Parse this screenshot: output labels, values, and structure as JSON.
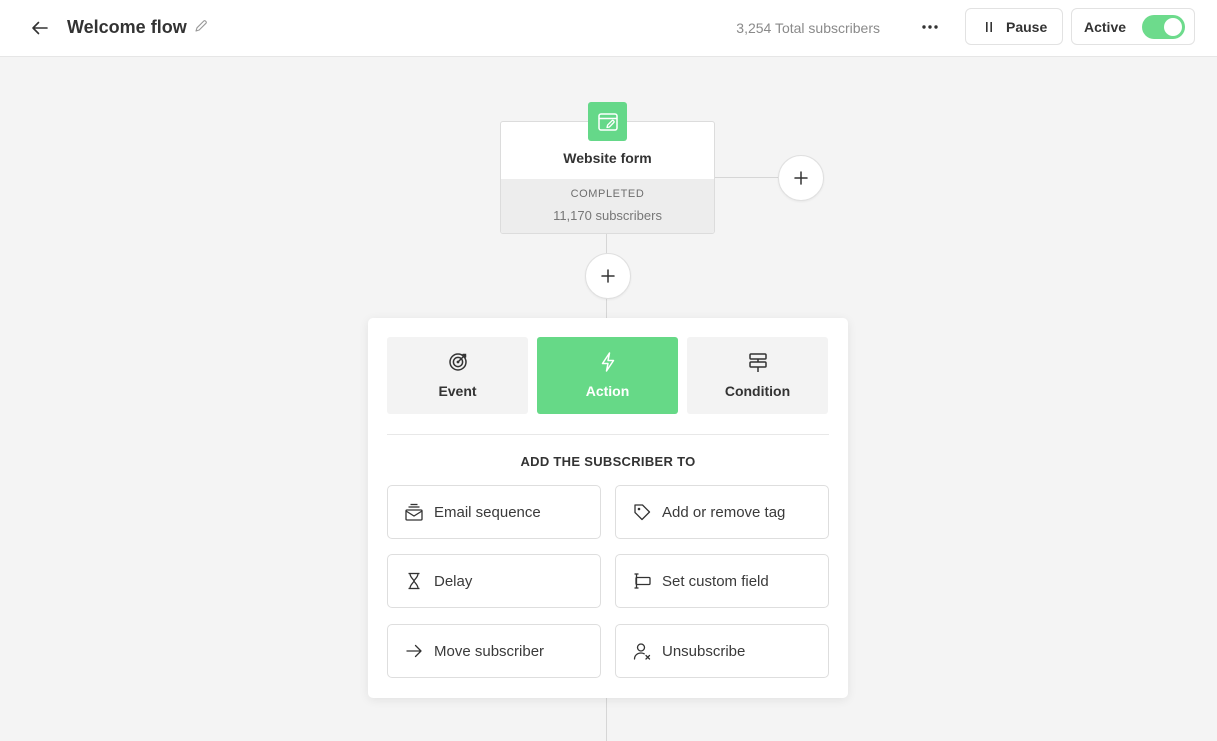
{
  "header": {
    "title": "Welcome flow",
    "subscriber_count": "3,254 Total subscribers",
    "pause_label": "Pause",
    "active_label": "Active",
    "active_on": true
  },
  "colors": {
    "accent": "#66d987",
    "toggle_on": "#6ddb8c"
  },
  "trigger": {
    "icon": "website-form-icon",
    "title": "Website form",
    "status": "COMPLETED",
    "count": "11,170 subscribers"
  },
  "picker": {
    "tabs": [
      {
        "label": "Event",
        "icon": "target-icon",
        "selected": false
      },
      {
        "label": "Action",
        "icon": "lightning-icon",
        "selected": true
      },
      {
        "label": "Condition",
        "icon": "signpost-icon",
        "selected": false
      }
    ],
    "heading": "ADD THE SUBSCRIBER TO",
    "options": [
      {
        "label": "Email sequence",
        "icon": "email-sequence-icon"
      },
      {
        "label": "Add or remove tag",
        "icon": "tag-icon"
      },
      {
        "label": "Delay",
        "icon": "hourglass-icon"
      },
      {
        "label": "Set custom field",
        "icon": "custom-field-icon"
      },
      {
        "label": "Move subscriber",
        "icon": "arrow-right-icon"
      },
      {
        "label": "Unsubscribe",
        "icon": "user-remove-icon"
      }
    ]
  }
}
